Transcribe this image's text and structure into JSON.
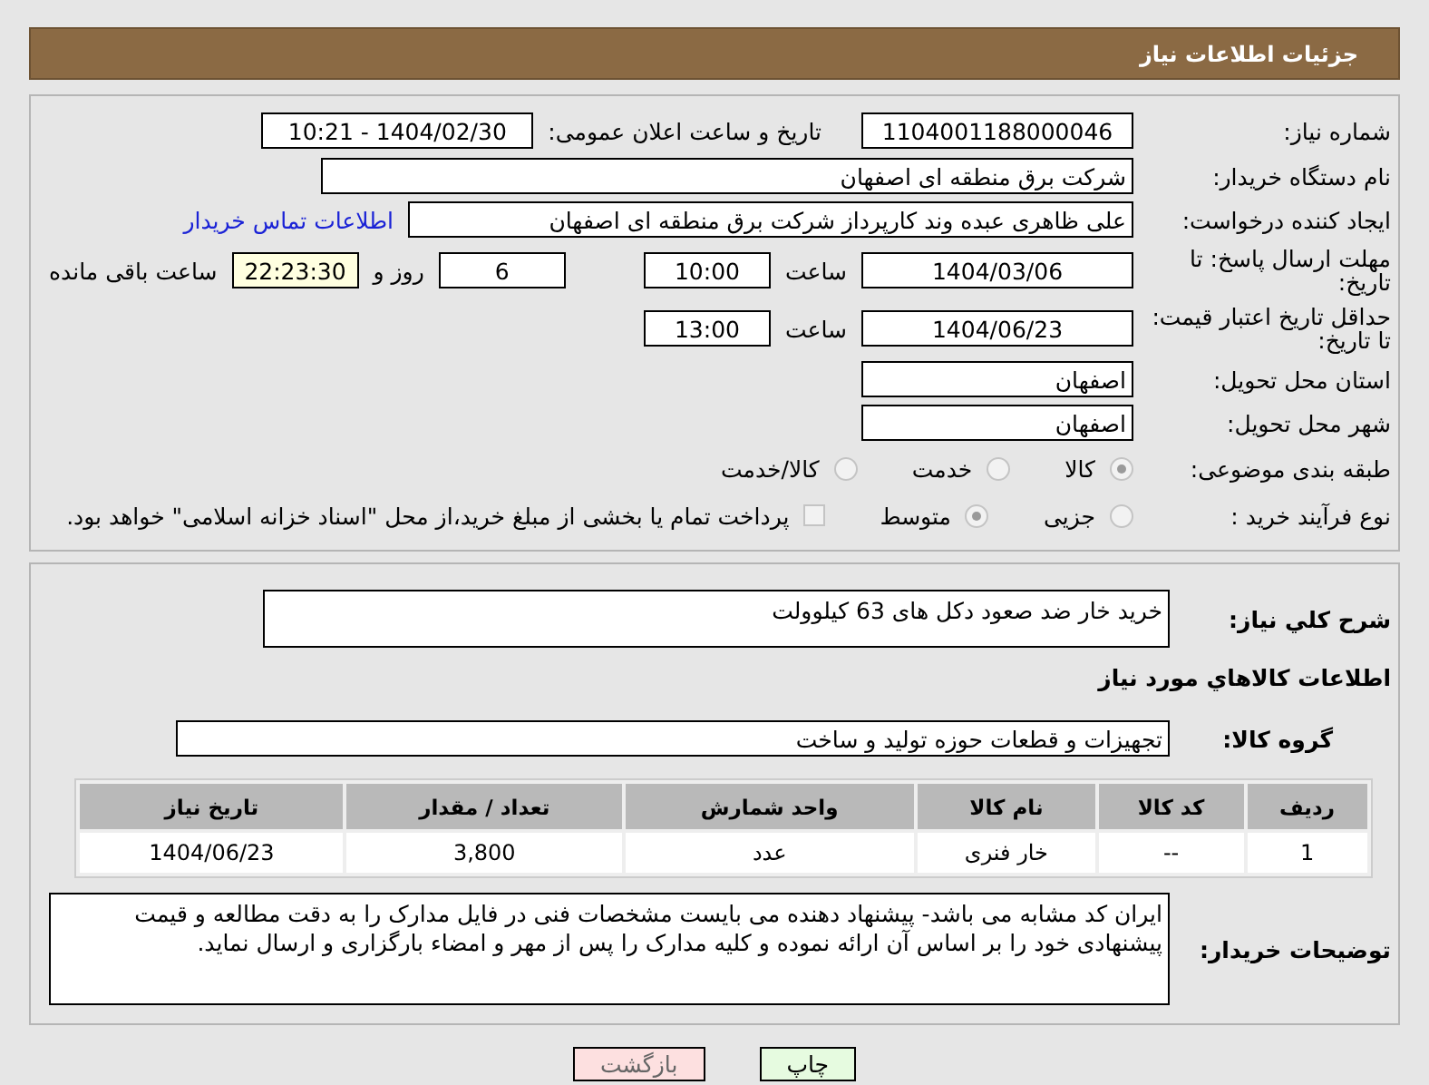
{
  "header": {
    "title": "جزئیات اطلاعات نیاز"
  },
  "need_number": {
    "label": "شماره نیاز:",
    "value": "1104001188000046"
  },
  "announce": {
    "label": "تاریخ و ساعت اعلان عمومی:",
    "value": "1404/02/30 - 10:21"
  },
  "buyer": {
    "label": "نام دستگاه خریدار:",
    "value": "شرکت برق منطقه ای اصفهان"
  },
  "creator": {
    "label": "ایجاد کننده درخواست:",
    "value": "علی ظاهری عبده وند کارپرداز شرکت برق منطقه ای اصفهان",
    "link": "اطلاعات تماس خریدار"
  },
  "deadline": {
    "label": "مهلت ارسال پاسخ: تا تاریخ:",
    "date": "1404/03/06",
    "time_label": "ساعت",
    "time": "10:00",
    "days": "6",
    "days_label": "روز و",
    "remaining": "22:23:30",
    "remaining_label": "ساعت باقی مانده"
  },
  "validity": {
    "label": "حداقل تاریخ اعتبار قیمت: تا تاریخ:",
    "date": "1404/06/23",
    "time_label": "ساعت",
    "time": "13:00"
  },
  "province": {
    "label": "استان محل تحویل:",
    "value": "اصفهان"
  },
  "city": {
    "label": "شهر محل تحویل:",
    "value": "اصفهان"
  },
  "category": {
    "label": "طبقه بندی موضوعی:",
    "options": [
      {
        "label": "کالا",
        "selected": true
      },
      {
        "label": "خدمت",
        "selected": false
      },
      {
        "label": "کالا/خدمت",
        "selected": false
      }
    ]
  },
  "process": {
    "label": "نوع فرآیند خرید :",
    "options": [
      {
        "label": "جزیی",
        "selected": false
      },
      {
        "label": "متوسط",
        "selected": true
      }
    ],
    "payment": {
      "checked": false,
      "label": "پرداخت تمام یا بخشی از مبلغ خرید،از محل \"اسناد خزانه اسلامی\" خواهد بود."
    }
  },
  "description": {
    "label": "شرح کلي نياز:",
    "value": "خرید خار ضد صعود دکل های 63 کیلوولت"
  },
  "goods_title": "اطلاعات کالاهاي مورد نياز",
  "goods_group": {
    "label": "گروه کالا:",
    "value": "تجهیزات و قطعات حوزه تولید و ساخت"
  },
  "table": {
    "columns": [
      "ردیف",
      "کد کالا",
      "نام کالا",
      "واحد شمارش",
      "تعداد / مقدار",
      "تاریخ نیاز"
    ],
    "rows": [
      [
        "1",
        "--",
        "خار فنری",
        "عدد",
        "3,800",
        "1404/06/23"
      ]
    ]
  },
  "notes": {
    "label": "توضیحات خریدار:",
    "value": "ایران کد مشابه می باشد- پیشنهاد دهنده می بایست مشخصات فنی در فایل مدارک  را به دقت مطالعه و قیمت پیشنهادی خود را بر اساس آن ارائه نموده و کلیه مدارک را پس از مهر و امضاء بارگزاری و ارسال نماید."
  },
  "buttons": [
    {
      "kind": "print",
      "label": "چاپ"
    },
    {
      "kind": "back",
      "label": "بازگشت"
    }
  ]
}
